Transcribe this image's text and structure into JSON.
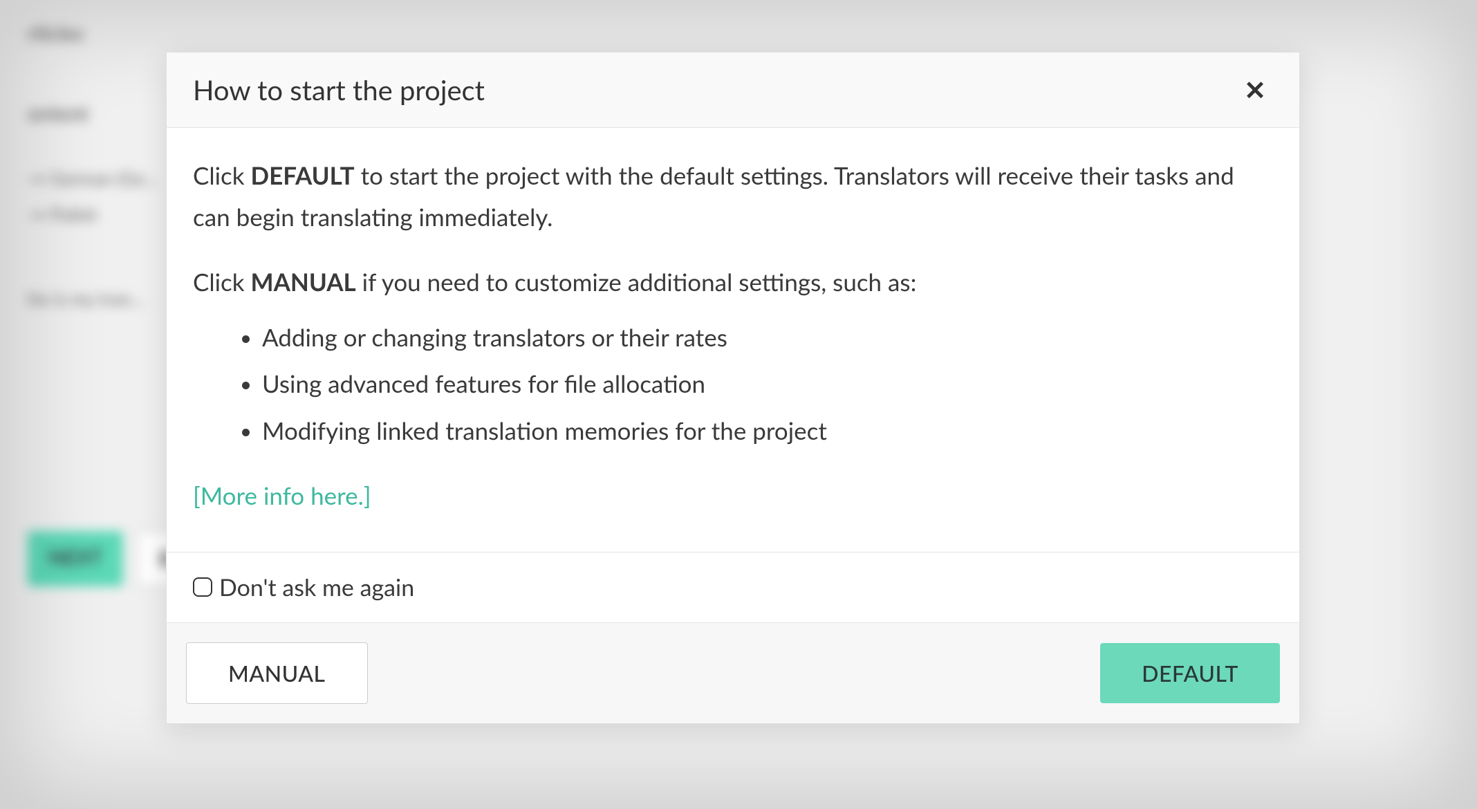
{
  "backdrop": {
    "item1": "rticles",
    "item2": "ontent",
    "item3": "→ German (Ge…",
    "item4": "→ Polish",
    "item5": "his is my tran…",
    "btn1": "NEXT",
    "btn2": "B"
  },
  "dialog": {
    "title": "How to start the project",
    "para1_prefix": "Click ",
    "para1_bold": "DEFAULT",
    "para1_suffix": " to start the project with the default settings. Translators will receive their tasks and can begin translating immediately.",
    "para2_prefix": "Click ",
    "para2_bold": "MANUAL",
    "para2_suffix": " if you need to customize additional settings, such as:",
    "bullets": [
      "Adding or changing translators or their rates",
      "Using advanced features for file allocation",
      "Modifying linked translation memories for the project"
    ],
    "link_text": "[More info here.]",
    "checkbox_label": "Don't ask me again",
    "btn_manual": "MANUAL",
    "btn_default": "DEFAULT"
  }
}
